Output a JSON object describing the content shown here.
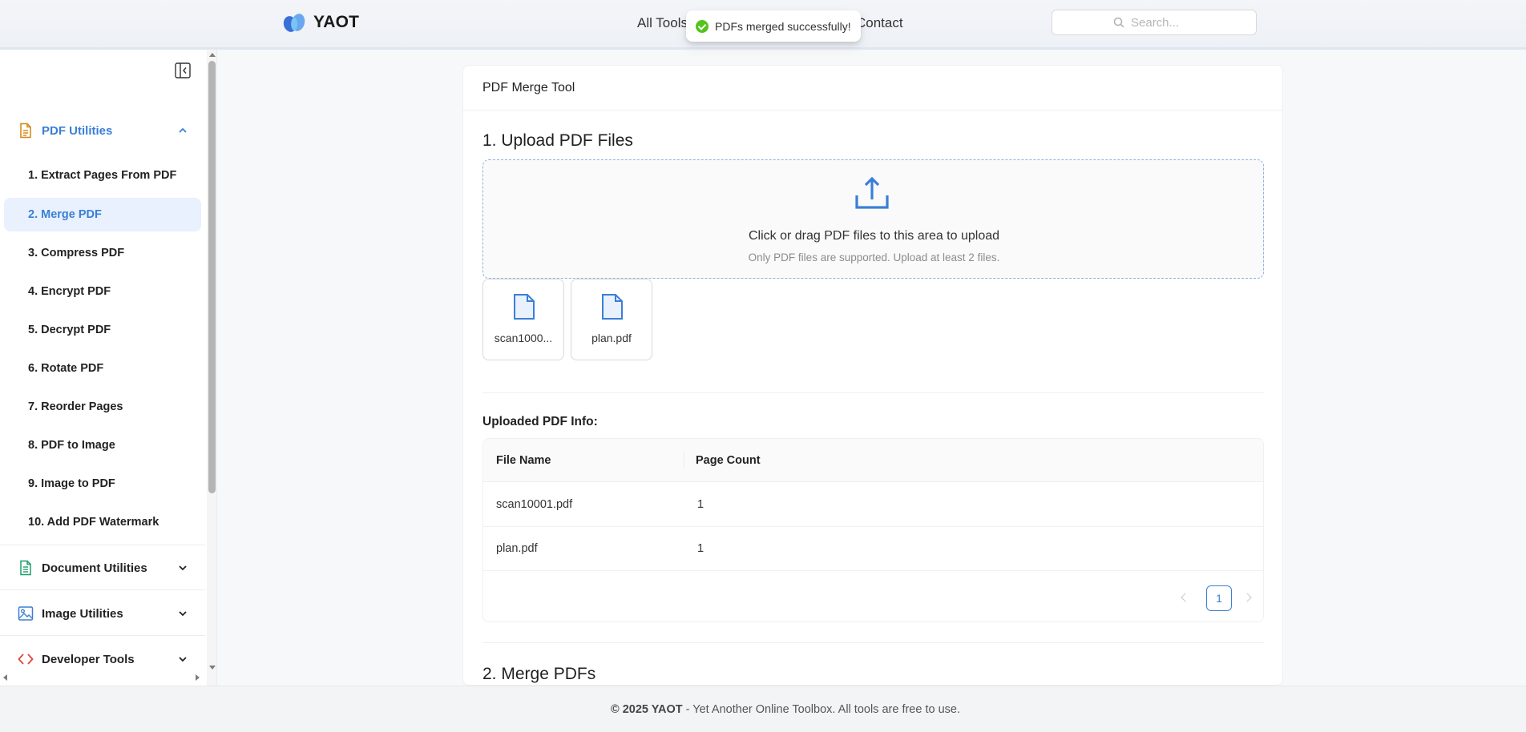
{
  "header": {
    "brand": "YAOT",
    "nav": {
      "all_tools": "All Tools",
      "contact": "Contact"
    },
    "search": {
      "placeholder": "Search..."
    },
    "toast": "PDFs merged successfully!"
  },
  "sidebar": {
    "groups": [
      {
        "label": "PDF Utilities",
        "icon": "pdf-file-icon",
        "expanded": true,
        "color": "#d4860b",
        "items": [
          {
            "label": "1. Extract Pages From PDF"
          },
          {
            "label": "2. Merge PDF",
            "active": true
          },
          {
            "label": "3. Compress PDF"
          },
          {
            "label": "4. Encrypt PDF"
          },
          {
            "label": "5. Decrypt PDF"
          },
          {
            "label": "6. Rotate PDF"
          },
          {
            "label": "7. Reorder Pages"
          },
          {
            "label": "8. PDF to Image"
          },
          {
            "label": "9. Image to PDF"
          },
          {
            "label": "10. Add PDF Watermark"
          }
        ]
      },
      {
        "label": "Document Utilities",
        "icon": "document-icon",
        "expanded": false,
        "color": "#1f9d6b"
      },
      {
        "label": "Image Utilities",
        "icon": "image-icon",
        "expanded": false,
        "color": "#3a7fd6"
      },
      {
        "label": "Developer Tools",
        "icon": "code-icon",
        "expanded": false,
        "color": "#e0453a"
      }
    ]
  },
  "main": {
    "card_title": "PDF Merge Tool",
    "upload": {
      "section_title": "1. Upload PDF Files",
      "prompt": "Click or drag PDF files to this area to upload",
      "hint": "Only PDF files are supported. Upload at least 2 files.",
      "files": [
        {
          "display_name": "scan1000...",
          "icon": "file-icon"
        },
        {
          "display_name": "plan.pdf",
          "icon": "file-icon"
        }
      ]
    },
    "info": {
      "label": "Uploaded PDF Info:",
      "columns": [
        "File Name",
        "Page Count"
      ],
      "rows": [
        {
          "file_name": "scan10001.pdf",
          "page_count": "1"
        },
        {
          "file_name": "plan.pdf",
          "page_count": "1"
        }
      ],
      "current_page": "1"
    },
    "merge": {
      "section_title": "2. Merge PDFs"
    }
  },
  "footer": {
    "copyright": "© 2025 YAOT",
    "text": "- Yet Another Online Toolbox. All tools are free to use."
  },
  "colors": {
    "accent": "#3a7fd6",
    "success": "#52c41a",
    "active_bg": "#e8f1fd"
  }
}
